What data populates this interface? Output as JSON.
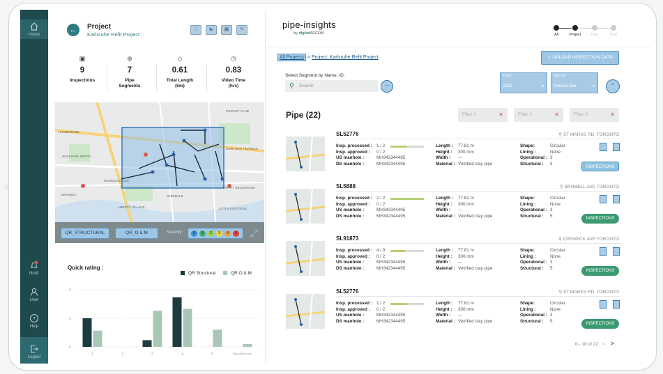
{
  "sidebar": {
    "home_label": "Home",
    "notifications_label": "Notif.",
    "user_label": "User",
    "help_label": "Help",
    "logout_label": "Logout"
  },
  "project": {
    "heading": "Project",
    "name": "Karlsruhe Refit Project"
  },
  "stats": [
    {
      "value": "9",
      "label": "Inspections"
    },
    {
      "value": "7",
      "label": "Pipe Segments"
    },
    {
      "value": "0.61",
      "label": "Total Length (km)"
    },
    {
      "value": "0.83",
      "label": "Video Time (hrs)"
    }
  ],
  "map_labels": {
    "humber": "HUMBERSIDE",
    "high_park": "HIGH PARK NORTH",
    "junction": "JUNCTION TRIANGLE",
    "roncesvalles": "RONCESVALLES",
    "parkdale": "PARKDALE",
    "liberty": "LIBERTY VILLAGE",
    "swansea": "SWANSEA",
    "little_portugal": "LITTLE PORTUGAL",
    "trinity": "TRINITY BELLWOODS",
    "cricket": "CRICKET CLUB"
  },
  "filters": {
    "qr_structural": "QR_STRUCTURAL",
    "qr_om": "QR_O & M",
    "severity_label": "Severity:",
    "severity_levels": [
      "0",
      "1",
      "2",
      "3",
      "4",
      "5"
    ]
  },
  "quick_rating": {
    "title": "Quick rating :",
    "legend_structural": "QR Structural",
    "legend_om": "QR O & M"
  },
  "chart_data": {
    "type": "bar",
    "categories": [
      "1",
      "2",
      "3",
      "4",
      "5",
      "No defects"
    ],
    "yticks": [
      "0",
      "3",
      "6"
    ],
    "ylim": [
      0,
      6
    ],
    "series": [
      {
        "name": "QR Structural",
        "color": "#1d3c40",
        "values": [
          3,
          0,
          0.7,
          5.2,
          0,
          0
        ]
      },
      {
        "name": "QR O & M",
        "color": "#a9c7b6",
        "values": [
          1.7,
          0,
          3.8,
          4,
          1.8,
          0.3
        ]
      }
    ]
  },
  "brand": {
    "logo": "pipe-insights",
    "byline_prefix": "by",
    "byline_brand": "digital",
    "byline_suffix": "AECOM"
  },
  "stepper": [
    "All",
    "Project",
    "Pipe",
    "Insp"
  ],
  "breadcrumb": {
    "all": "All Projects",
    "sep": " > ",
    "current": "Project: Karlsruhe Refit Project"
  },
  "upload_label": "UPLOAD INSPECTION DATA",
  "segment_search": {
    "label": "Select Segment by Name, ID:",
    "placeholder": "Search"
  },
  "time_select": {
    "label": "Time",
    "value": "2022"
  },
  "sort_select": {
    "label": "Sort by",
    "value": "Choose one"
  },
  "pipe_heading": "Pipe (22)",
  "pipe_filters": [
    "Filter 1",
    "Filter 2",
    "Filter 3"
  ],
  "cards": [
    {
      "id": "SL52776",
      "location": "ST MARKS RD, TORONTO",
      "processed": "1 / 2",
      "processed_frac": 0.5,
      "approved": "0 / 2",
      "us": "MH342344495",
      "ds": "MH342344495",
      "length": "77.81 m",
      "height": "300 mm",
      "width": "---",
      "material": "Vetrified clay pipe",
      "shape": "Circular",
      "lining": "None",
      "operational": "3",
      "structural": "5",
      "btn": "INSPECTIONS",
      "hl": true
    },
    {
      "id": "SL5888",
      "location": "BRUMELL AVE TORONTO",
      "processed": "2 / 2",
      "processed_frac": 1,
      "approved": "0 / 2",
      "us": "MH342344495",
      "ds": "MH342344495",
      "length": "77.81 m",
      "height": "300 mm",
      "width": "---",
      "material": "Vetrified clay pipe",
      "shape": "Circular",
      "lining": "None",
      "operational": "3",
      "structural": "5",
      "btn": "INSPECTIONS",
      "hl": false
    },
    {
      "id": "SL91873",
      "location": "CHISWICK AVE TORONTO",
      "processed": "4 / 9",
      "processed_frac": 0.44,
      "approved": "0 / 2",
      "us": "MH342344495",
      "ds": "MH342344495",
      "length": "77.81 m",
      "height": "300 mm",
      "width": "---",
      "material": "Vetrified clay pipe",
      "shape": "Circular",
      "lining": "None",
      "operational": "3",
      "structural": "5",
      "btn": "INSPECTIONS",
      "hl": false
    },
    {
      "id": "SL52776",
      "location": "ST MARKS RD, TORONTO",
      "processed": "1 / 2",
      "processed_frac": 0.5,
      "approved": "0 / 2",
      "us": "MH342344495",
      "ds": "MH342344495",
      "length": "77.81 m",
      "height": "300 mm",
      "width": "---",
      "material": "Vetrified clay pipe",
      "shape": "Circular",
      "lining": "None",
      "operational": "3",
      "structural": "5",
      "btn": "INSPECTIONS",
      "hl": false
    }
  ],
  "field_labels": {
    "processed": "Insp. processed :",
    "approved": "Insp. approved :",
    "us": "US manhole :",
    "ds": "DS manhole :",
    "length": "Length :",
    "height": "Height :",
    "width": "Width :",
    "material": "Material :",
    "shape": "Shape:",
    "lining": "Lining :",
    "operational": "Operational :",
    "structural": "Structural :"
  },
  "pager": {
    "text": "0 - 10 of 22"
  }
}
